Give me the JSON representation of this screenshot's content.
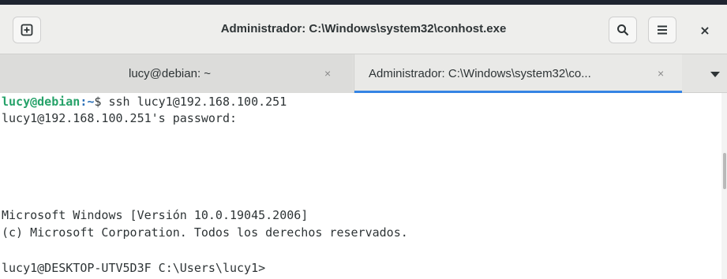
{
  "window": {
    "title": "Administrador: C:\\Windows\\system32\\conhost.exe",
    "close_glyph": "×"
  },
  "icons": {
    "new_tab": "new-tab-icon",
    "search": "search-icon",
    "menu": "hamburger-menu-icon",
    "close": "close-icon",
    "tabs_dropdown": "chevron-down-icon"
  },
  "tabs": [
    {
      "label": "lucy@debian: ~",
      "close_glyph": "×",
      "active": false
    },
    {
      "label": "Administrador: C:\\Windows\\system32\\co...",
      "close_glyph": "×",
      "active": true
    }
  ],
  "terminal": {
    "line1": {
      "user_host": "lucy@debian",
      "path": ":~",
      "rest": "$ ssh lucy1@192.168.100.251"
    },
    "line2": "lucy1@192.168.100.251's password:",
    "line3": "Microsoft Windows [Versión 10.0.19045.2006]",
    "line4": "(c) Microsoft Corporation. Todos los derechos reservados.",
    "line5": "lucy1@DESKTOP-UTV5D3F C:\\Users\\lucy1>"
  },
  "colors": {
    "accent": "#3584e4",
    "prompt_user": "#26a269",
    "prompt_path": "#2a6fb7"
  }
}
